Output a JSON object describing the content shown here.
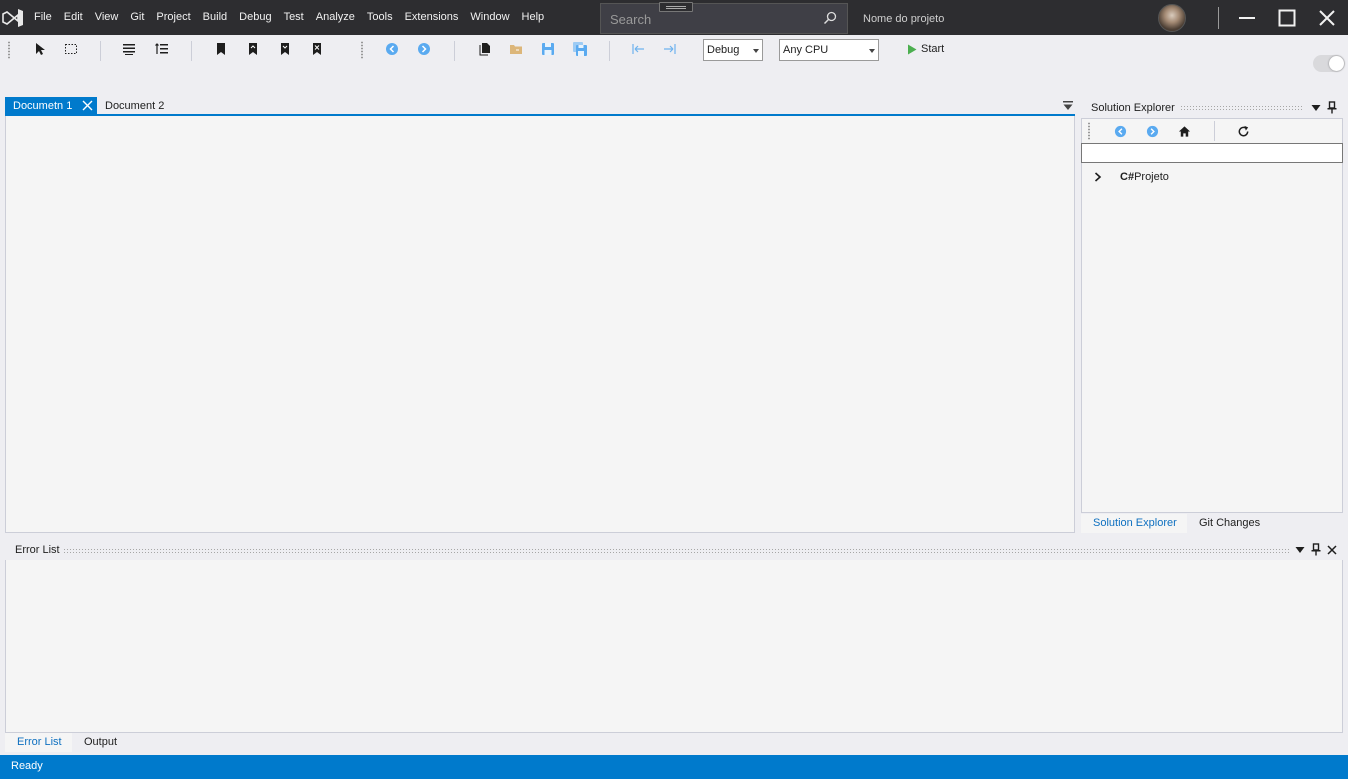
{
  "menu": {
    "items": [
      "File",
      "Edit",
      "View",
      "Git",
      "Project",
      "Build",
      "Debug",
      "Test",
      "Analyze",
      "Tools",
      "Extensions",
      "Window",
      "Help"
    ]
  },
  "search": {
    "placeholder": "Search"
  },
  "project_name": "Nome do projeto",
  "toolbar": {
    "configuration": "Debug",
    "platform": "Any CPU",
    "start_label": "Start"
  },
  "documents": {
    "tabs": [
      "Documetn 1",
      "Document 2"
    ],
    "active": 0
  },
  "solution_explorer": {
    "title": "Solution Explorer",
    "tree": {
      "badge": "C#",
      "label": "Projeto"
    },
    "bottom_tabs": [
      "Solution Explorer",
      "Git Changes"
    ]
  },
  "error_list": {
    "title": "Error List",
    "bottom_tabs": [
      "Error List",
      "Output"
    ]
  },
  "status": {
    "text": "Ready"
  },
  "colors": {
    "accent": "#007acc",
    "titlebar": "#2d2d30",
    "toolbar": "#eeeef2"
  }
}
